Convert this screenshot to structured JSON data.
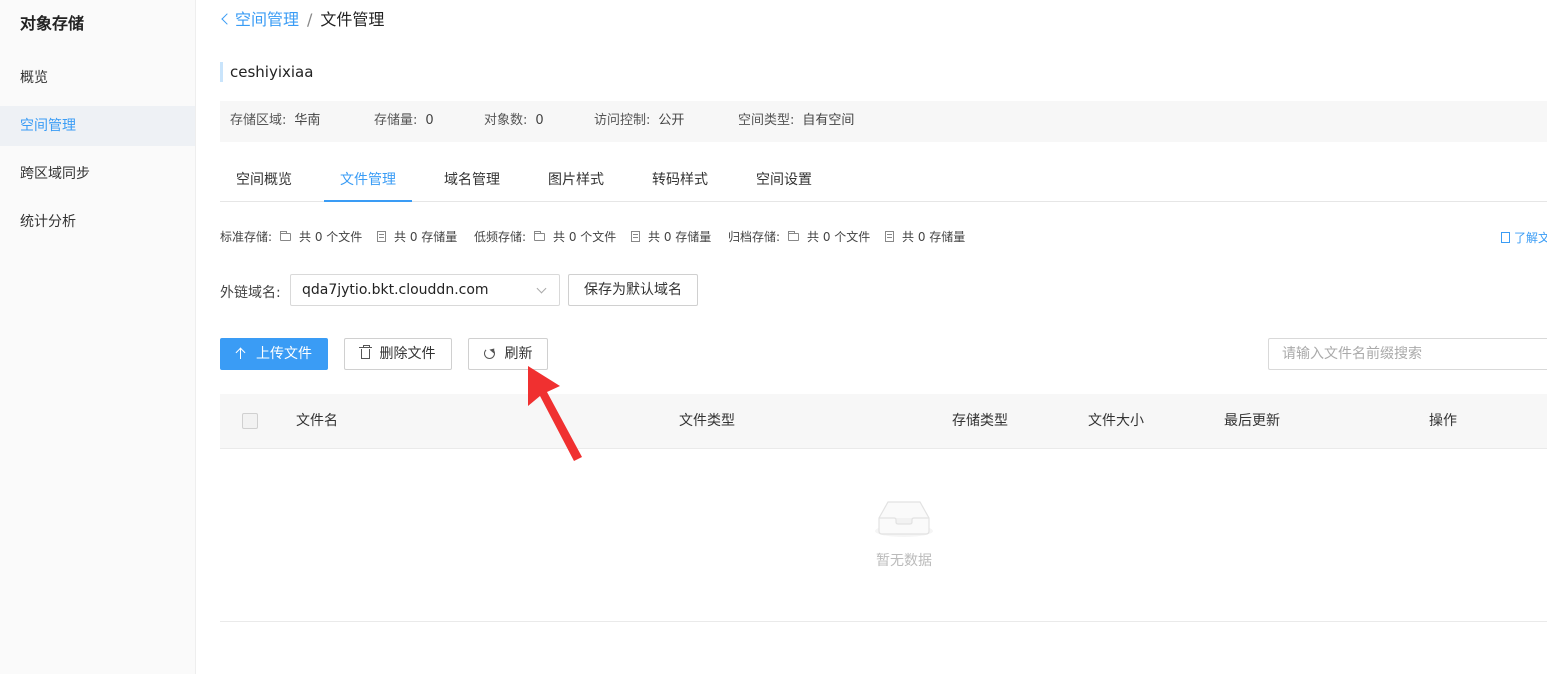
{
  "sidebar": {
    "title": "对象存储",
    "items": [
      {
        "label": "概览"
      },
      {
        "label": "空间管理"
      },
      {
        "label": "跨区域同步"
      },
      {
        "label": "统计分析"
      }
    ]
  },
  "breadcrumb": {
    "back": "空间管理",
    "separator": "/",
    "current": "文件管理"
  },
  "bucket": {
    "name": "ceshiyixiaa",
    "info": [
      {
        "label": "存储区域:",
        "value": "华南"
      },
      {
        "label": "存储量:",
        "value": "0"
      },
      {
        "label": "对象数:",
        "value": "0"
      },
      {
        "label": "访问控制:",
        "value": "公开"
      },
      {
        "label": "空间类型:",
        "value": "自有空间"
      }
    ]
  },
  "tabs": [
    {
      "label": "空间概览"
    },
    {
      "label": "文件管理"
    },
    {
      "label": "域名管理"
    },
    {
      "label": "图片样式"
    },
    {
      "label": "转码样式"
    },
    {
      "label": "空间设置"
    }
  ],
  "active_tab": "文件管理",
  "stats": {
    "standard": {
      "label": "标准存储:",
      "files": "共 0 个文件",
      "size": "共 0 存储量"
    },
    "low_freq": {
      "label": "低频存储:",
      "files": "共 0 个文件",
      "size": "共 0 存储量"
    },
    "archive": {
      "label": "归档存储:",
      "files": "共 0 个文件",
      "size": "共 0 存储量"
    },
    "learn_more": "了解文"
  },
  "domain": {
    "label": "外链域名:",
    "selected": "qda7jytio.bkt.clouddn.com",
    "save_default": "保存为默认域名"
  },
  "toolbar": {
    "upload": "上传文件",
    "delete": "删除文件",
    "refresh": "刷新",
    "search_placeholder": "请输入文件名前缀搜索"
  },
  "table": {
    "columns": [
      "文件名",
      "文件类型",
      "存储类型",
      "文件大小",
      "最后更新",
      "操作"
    ],
    "rows": [],
    "empty_text": "暂无数据"
  },
  "colors": {
    "accent": "#3a9cf5",
    "annotation": "#f03030"
  }
}
